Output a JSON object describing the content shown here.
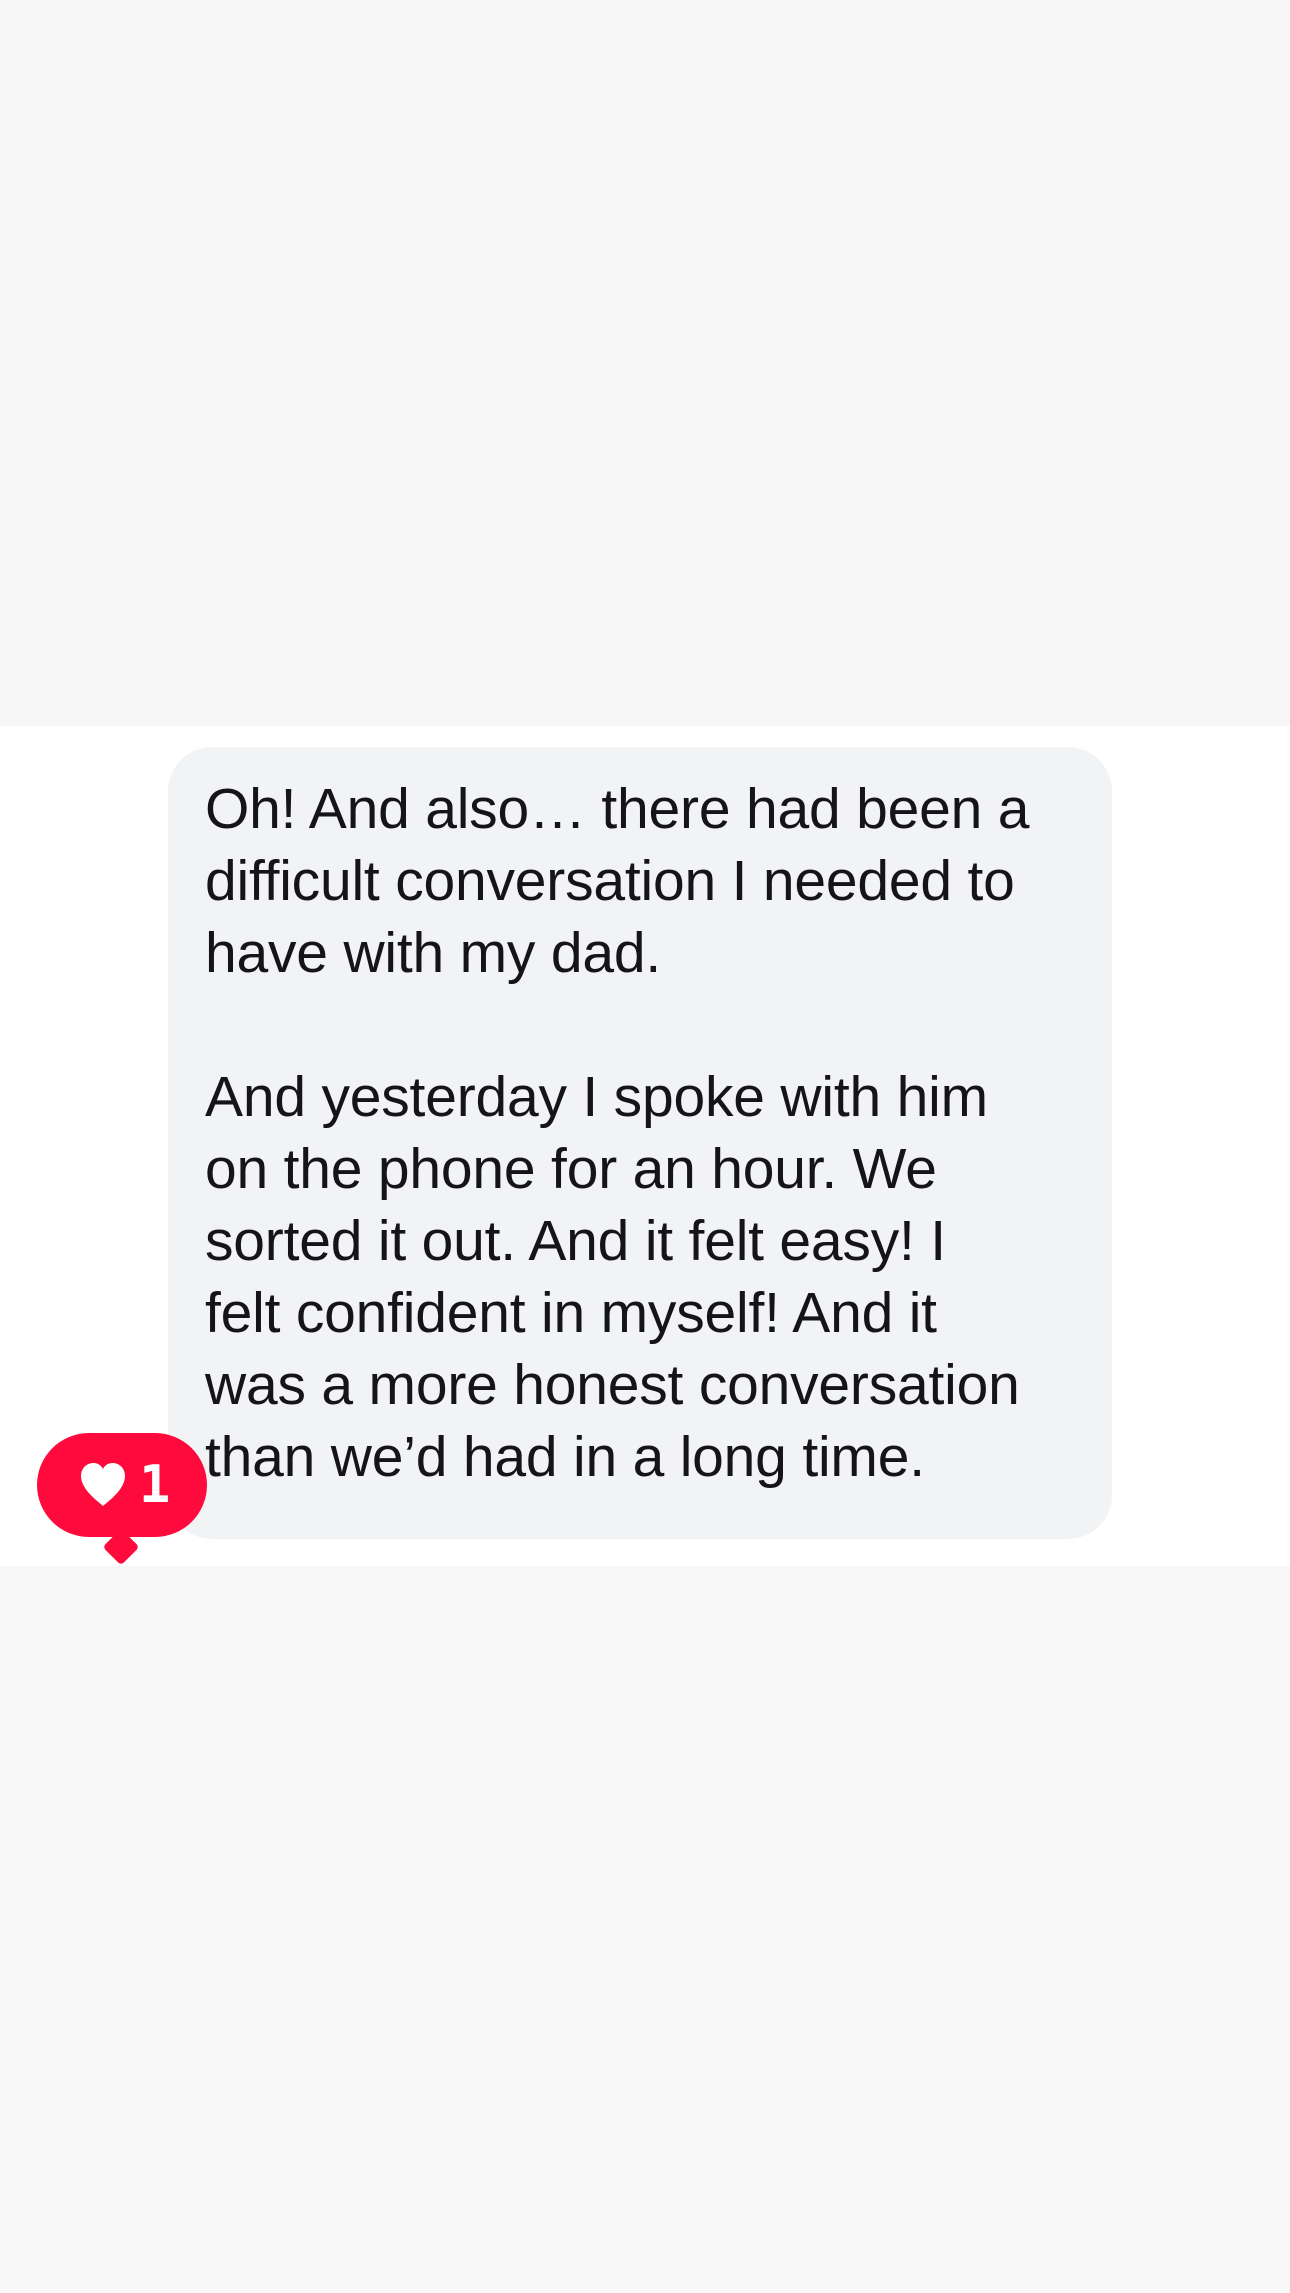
{
  "message": {
    "paragraphs": [
      "Oh! And also… there had been a\ndifficult conversation I needed to\nhave with my dad.",
      "And yesterday I spoke with him\non the phone for an hour. We\nsorted it out. And it felt easy! I\nfelt confident in myself! And it\nwas a more honest conversation\nthan we’d had in a long time."
    ]
  },
  "reaction": {
    "icon": "heart-icon",
    "count": "1",
    "color": "#ff0a3c"
  },
  "colors": {
    "bubble_background": "#f2f3f5",
    "text": "#14141a",
    "page_background": "#f7f7f8"
  }
}
